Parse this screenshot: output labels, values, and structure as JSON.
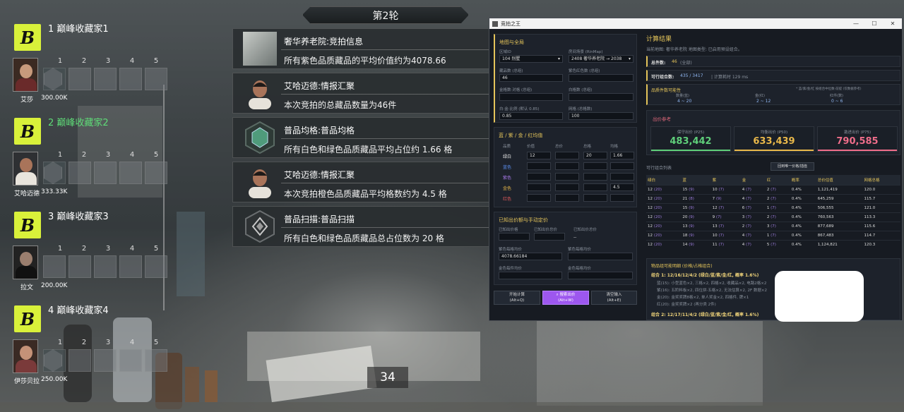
{
  "round": {
    "title": "第2轮"
  },
  "timer": "34",
  "players": [
    {
      "rank": "1",
      "name": "巅峰收藏家1",
      "avatar_name": "艾莎",
      "value": "300.00K",
      "slots": [
        "1",
        "2",
        "3",
        "4",
        "5"
      ],
      "highlight": false
    },
    {
      "rank": "2",
      "name": "巅峰收藏家2",
      "avatar_name": "艾哈迈德",
      "value": "333.33K",
      "slots": [
        "1",
        "2",
        "3",
        "4",
        "5"
      ],
      "highlight": true
    },
    {
      "rank": "3",
      "name": "巅峰收藏家3",
      "avatar_name": "拉文",
      "value": "200.00K",
      "slots": [
        "1",
        "2",
        "3",
        "4",
        "5"
      ],
      "highlight": false
    },
    {
      "rank": "4",
      "name": "巅峰收藏家4",
      "avatar_name": "伊莎贝拉",
      "value": "250.00K",
      "slots": [
        "1",
        "2",
        "3",
        "4",
        "5"
      ],
      "highlight": false
    }
  ],
  "events": [
    {
      "title": "奢华养老院:竞拍信息",
      "text": "所有紫色品质藏品的平均价值约为4078.66",
      "icon": "room-photo-icon"
    },
    {
      "title": "艾哈迈德:情报汇聚",
      "text": "本次竞拍的总藏品数量为46件",
      "icon": "ahmed-portrait-icon"
    },
    {
      "title": "普品均格:普品均格",
      "text": "所有白色和绿色品质藏品平均占位约 1.66 格",
      "icon": "green-gem-icon"
    },
    {
      "title": "艾哈迈德:情报汇聚",
      "text": "本次竞拍橙色品质藏品平均格数约为 4.5 格",
      "icon": "ahmed-portrait-icon"
    },
    {
      "title": "普品扫描:普品扫描",
      "text": "所有白色和绿色品质藏品总占位数为 20 格",
      "icon": "grey-gem-icon"
    }
  ],
  "tool": {
    "window_title": "竞拍之王",
    "left": {
      "map_section": "地图与全局",
      "map_label": "区域ID",
      "map_value": "104 别墅",
      "preset_label": "房间场景 (RinMap)",
      "preset_value": "2408 奢华养老院 → 2038",
      "total_items_label": "藏品数 (总组)",
      "total_items_value": "46",
      "purple_label": "紫色红色数 (总组)",
      "purple_value": "",
      "gold_label": "金格数·对格 (总组)",
      "gold_value": "",
      "white_label": "白格数 (总组)",
      "white_value": "",
      "conf_label": "白·金·比例 (默认 0.85)",
      "conf_value": "0.85",
      "cells_label": "网格 (总格数)",
      "cells_value": "100",
      "grid_section": "蓝 / 紫 / 金 / 红均值",
      "grid_headers": [
        "品质",
        "价值",
        "总价",
        "总格",
        "均格"
      ],
      "grid_rows": [
        {
          "q": "绿白",
          "c": [
            "12",
            "",
            "20",
            "1.66"
          ],
          "color": "#e6e6e6"
        },
        {
          "q": "蓝色",
          "c": [
            "",
            "",
            "",
            ""
          ],
          "color": "#5b8ef0"
        },
        {
          "q": "紫色",
          "c": [
            "",
            "",
            "",
            ""
          ],
          "color": "#a779e8"
        },
        {
          "q": "金色",
          "c": [
            "",
            "",
            "",
            "4.5"
          ],
          "color": "#e9b84a"
        },
        {
          "q": "红色",
          "c": [
            "",
            "",
            "",
            ""
          ],
          "color": "#e05a5a"
        }
      ],
      "bid_section": "已知出价额与手动定价",
      "bid_a_label": "已知出价格",
      "bid_b_label": "已知出价总价",
      "bid_c_label": "已知出价总价",
      "bid_c_value": "--",
      "purple_avg_label": "紫色每格均价",
      "purple_avg_value": "4078.66184",
      "purple_cell_label": "紫色每格均价",
      "gold_avg_label": "金色每件均价",
      "gold_cell_label": "金色每格均价",
      "btn_start": {
        "line1": "开始计算",
        "line2": "(Alt+Q)"
      },
      "btn_search": {
        "line1": "搜索出价",
        "line2": "(Alt+W)"
      },
      "btn_reset": {
        "line1": "清空输入",
        "line2": "(Alt+E)"
      }
    },
    "right": {
      "title": "计算结果",
      "subtitle": "当前地图: 奢华养老院 地图类型: 已启用预设组合。",
      "total_label": "总件数:",
      "total_value": "46",
      "total_note": "(全部)",
      "combo_label": "可行组合数:",
      "combo_value": "435 / 3417",
      "combo_note": "| 计算耗时 129 ms",
      "range_title": "品质件数可能性",
      "range_note": "* 蓝/紫/金/红 按组合中位数·前提 (仅数据参考)",
      "ranges": [
        {
          "label": "数量(蓝)",
          "value": "4 ~ 20"
        },
        {
          "label": "金(红)",
          "value": "2 ~ 12"
        },
        {
          "label": "红件(数)",
          "value": "0 ~ 6"
        }
      ],
      "bid_ref_title": "出价参考",
      "cards": [
        {
          "label": "保守出价 (P25)",
          "value": "483,442",
          "color": "#5fcf7a"
        },
        {
          "label": "均衡出价 (P50)",
          "value": "633,439",
          "color": "#e9b84a"
        },
        {
          "label": "激进出价 (P75)",
          "value": "790,585",
          "color": "#ef6d8a"
        }
      ],
      "list_title": "可行组合列表",
      "list_button": "回到唯一价格/插值",
      "columns": [
        "绿白",
        "蓝",
        "紫",
        "金",
        "红",
        "概率",
        "总价估值",
        "网格总格"
      ],
      "rows": [
        [
          "12 (20)",
          "15 (9)",
          "10 (7)",
          "4 (7)",
          "2 (7)",
          "0.4%",
          "1,121,419",
          "120.0"
        ],
        [
          "12 (20)",
          "21 (8)",
          "7 (9)",
          "4 (7)",
          "2 (7)",
          "0.4%",
          "645,259",
          "115.7"
        ],
        [
          "12 (20)",
          "15 (9)",
          "12 (7)",
          "6 (7)",
          "1 (7)",
          "0.4%",
          "506,555",
          "121.0"
        ],
        [
          "12 (20)",
          "20 (9)",
          "9 (7)",
          "3 (7)",
          "2 (7)",
          "0.4%",
          "760,563",
          "113.3"
        ],
        [
          "12 (20)",
          "13 (9)",
          "13 (7)",
          "2 (7)",
          "3 (7)",
          "0.4%",
          "877,689",
          "115.6"
        ],
        [
          "12 (20)",
          "18 (9)",
          "10 (7)",
          "4 (7)",
          "1 (7)",
          "0.4%",
          "867,483",
          "114.7"
        ],
        [
          "12 (20)",
          "14 (9)",
          "11 (7)",
          "4 (7)",
          "5 (7)",
          "0.4%",
          "1,124,821",
          "120.3"
        ]
      ],
      "detail_title": "物品组可能明细 (价格/占格组合)",
      "combo1": "组合 1: 12/16/12/4/2 (绿白/蓝/紫/金/红, 概率 1.6%)",
      "combo1_lines": [
        "蓝(15): 小型蓝色×2, 三格×2, 四格×2, 收藏品×2, 电路2格×2",
        "紫(16): 五阶料板×2, 四位拼·五格×2, 无法估算×2, 2F 数据×2",
        "金(20): 金奖奖牌8格×2, 单人奖金×2, 四格件, 牌×1",
        "红(20): 金奖奖牌×2 (再分类 2件)"
      ],
      "combo2": "组合 2: 12/17/11/4/2 (绿白/蓝/紫/金/红, 概率 1.6%)"
    }
  },
  "colors": {
    "accent_gold": "#e4c45a",
    "logo_yellow": "#d9f13a",
    "highlight_green": "#5fdc78",
    "purple_button": "#9d57ef"
  }
}
